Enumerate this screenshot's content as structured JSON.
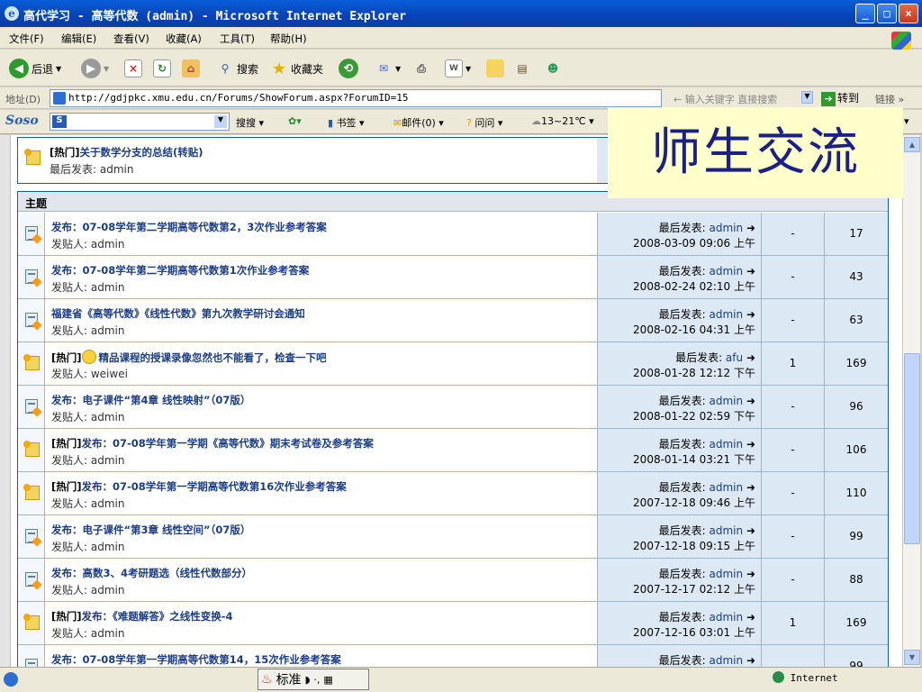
{
  "window": {
    "title": "高代学习 - 高等代数 (admin) - Microsoft Internet Explorer"
  },
  "menu": [
    "文件(F)",
    "编辑(E)",
    "查看(V)",
    "收藏(A)",
    "工具(T)",
    "帮助(H)"
  ],
  "toolbar": {
    "back": "后退",
    "search": "搜索",
    "favorites": "收藏夹"
  },
  "address": {
    "label": "地址(D)",
    "url": "http://gdjpkc.xmu.edu.cn/Forums/ShowForum.aspx?ForumID=15",
    "search_hint": "输入关键字 直接搜索",
    "go": "转到",
    "links": "链接"
  },
  "soso": {
    "brand": "Soso",
    "search_btn": "搜搜",
    "bookmark": "书签",
    "mail": "邮件(0)",
    "ask": "问问",
    "weather": "13~21℃"
  },
  "overlay": "师生交流",
  "hot_post": {
    "tag": "[热门]",
    "title": "关于数学分支的总结(转贴)",
    "meta_label": "最后发表: ",
    "meta_user": "admin"
  },
  "section_header": "主题",
  "labels": {
    "poster": "发贴人: ",
    "last_post": "最后发表: "
  },
  "topics": [
    {
      "hot": false,
      "title": "发布：07-08学年第二学期高等代数第2，3次作业参考答案",
      "poster": "admin",
      "last_user": "admin",
      "last_time": "2008-03-09 09:06 上午",
      "replies": "-",
      "views": "17"
    },
    {
      "hot": false,
      "title": "发布：07-08学年第二学期高等代数第1次作业参考答案",
      "poster": "admin",
      "last_user": "admin",
      "last_time": "2008-02-24 02:10 上午",
      "replies": "-",
      "views": "43"
    },
    {
      "hot": false,
      "title": "福建省《高等代数》《线性代数》第九次教学研讨会通知",
      "poster": "admin",
      "last_user": "admin",
      "last_time": "2008-02-16 04:31 上午",
      "replies": "-",
      "views": "63"
    },
    {
      "hot": true,
      "tag": "[热门]",
      "title": "精品课程的授课录像忽然也不能看了，检查一下吧",
      "poster": "weiwei",
      "last_user": "afu",
      "last_time": "2008-01-28 12:12 下午",
      "replies": "1",
      "views": "169"
    },
    {
      "hot": false,
      "title": "发布：电子课件“第4章 线性映射”（07版）",
      "poster": "admin",
      "last_user": "admin",
      "last_time": "2008-01-22 02:59 下午",
      "replies": "-",
      "views": "96"
    },
    {
      "hot": true,
      "tag": "[热门]",
      "title": "发布：07-08学年第一学期《高等代数》期末考试卷及参考答案",
      "poster": "admin",
      "last_user": "admin",
      "last_time": "2008-01-14 03:21 下午",
      "replies": "-",
      "views": "106"
    },
    {
      "hot": true,
      "tag": "[热门]",
      "title": "发布：07-08学年第一学期高等代数第16次作业参考答案",
      "poster": "admin",
      "last_user": "admin",
      "last_time": "2007-12-18 09:46 上午",
      "replies": "-",
      "views": "110"
    },
    {
      "hot": false,
      "title": "发布：电子课件“第3章 线性空间”（07版）",
      "poster": "admin",
      "last_user": "admin",
      "last_time": "2007-12-18 09:15 上午",
      "replies": "-",
      "views": "99"
    },
    {
      "hot": false,
      "title": "发布：高数3、4考研题选（线性代数部分）",
      "poster": "admin",
      "last_user": "admin",
      "last_time": "2007-12-17 02:12 上午",
      "replies": "-",
      "views": "88"
    },
    {
      "hot": true,
      "tag": "[热门]",
      "title": "发布：《难题解答》之线性变换-4",
      "poster": "admin",
      "last_user": "admin",
      "last_time": "2007-12-16 03:01 上午",
      "replies": "1",
      "views": "169"
    },
    {
      "hot": false,
      "title": "发布：07-08学年第一学期高等代数第14，15次作业参考答案",
      "poster": "",
      "last_user": "admin",
      "last_time": "",
      "replies": "",
      "views": "99"
    }
  ],
  "status": {
    "ime": "标准",
    "zone": "Internet"
  }
}
